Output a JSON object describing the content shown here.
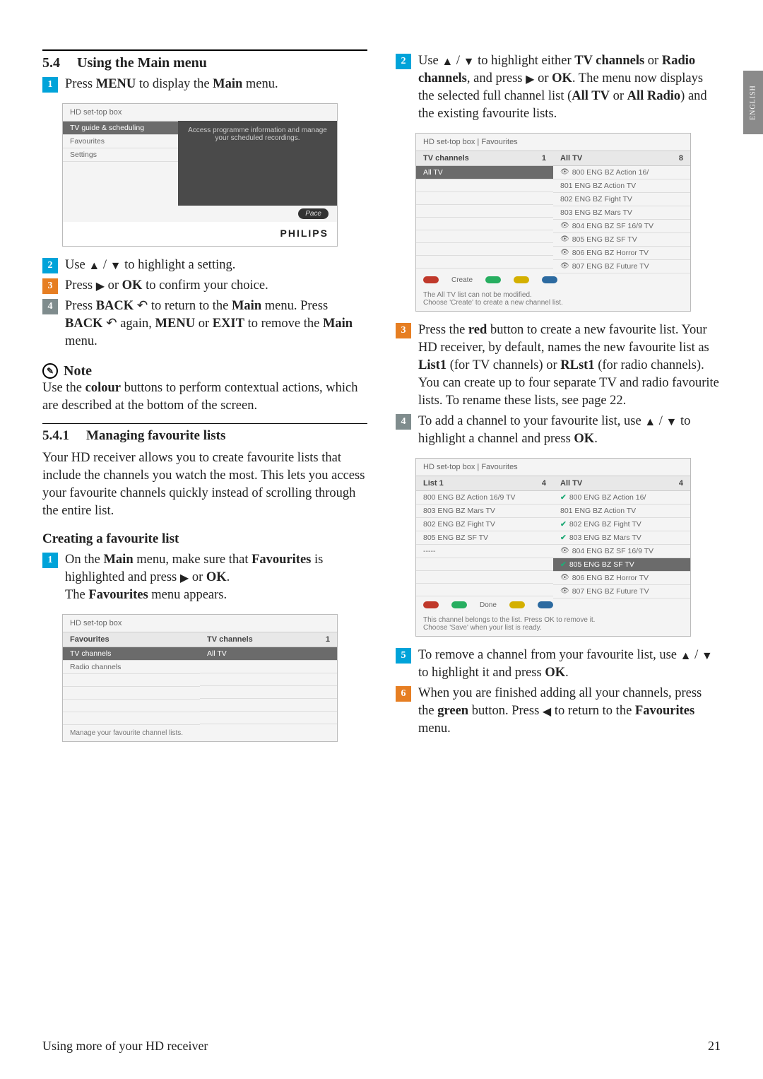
{
  "side_tab": "ENGLISH",
  "sec54": {
    "num": "5.4",
    "title": "Using the Main menu"
  },
  "sec541": {
    "num": "5.4.1",
    "title": "Managing favourite lists"
  },
  "create_hdr": "Creating a favourite list",
  "steps_left_a": {
    "s1": {
      "pre": "Press ",
      "b1": "MENU",
      "mid": " to display the ",
      "b2": "Main",
      "post": " menu."
    },
    "s2": {
      "pre": "Use ",
      "tri1": "▲",
      "slash": " / ",
      "tri2": "▼",
      "post": " to highlight a setting."
    },
    "s3": {
      "pre": "Press ",
      "tri": "▶",
      "mid": " or ",
      "b1": "OK",
      "post": " to confirm your choice."
    },
    "s4": {
      "pre": "Press ",
      "b1": "BACK",
      "icon": " ↶ ",
      "mid1": "to return to the ",
      "b2": "Main",
      "mid2": " menu. Press ",
      "b3": "BACK",
      "icon2": " ↶ ",
      "mid3": "again, ",
      "b4": "MENU",
      "mid4": " or ",
      "b5": "EXIT",
      "mid5": " to remove the ",
      "b6": "Main",
      "post": " menu."
    }
  },
  "note": {
    "label": "Note",
    "body_pre": "Use the ",
    "body_b": "colour",
    "body_post": " buttons to perform contextual actions, which are described at the bottom of the screen."
  },
  "para541": "Your HD receiver allows you to create favourite lists that include the channels you watch the most. This lets you access your favourite channels quickly instead of scrolling through the entire list.",
  "steps_left_b": {
    "s1": {
      "pre": "On the ",
      "b1": "Main",
      "mid1": " menu, make sure that ",
      "b2": "Favourites",
      "mid2": " is highlighted and press ",
      "tri": "▶",
      "mid3": " or ",
      "b3": "OK",
      "post": "."
    },
    "s1b": {
      "pre": "The ",
      "b1": "Favourites",
      "post": " menu appears."
    }
  },
  "steps_right": {
    "s2": {
      "pre": "Use ",
      "tri1": "▲",
      "slash": " / ",
      "tri2": "▼",
      "mid1": " to highlight either ",
      "b1": "TV channels",
      "mid2": " or ",
      "b2": "Radio channels",
      "mid3": ", and press ",
      "tri3": "▶",
      "mid4": " or ",
      "b3": "OK",
      "post1": ". The menu now displays the selected full channel list (",
      "b4": "All TV",
      "mid5": " or ",
      "b5": "All Radio",
      "post2": ") and the existing favourite lists."
    },
    "s3": {
      "pre": "Press the ",
      "b1": "red",
      "mid1": " button to create a new favourite list. Your HD receiver, by default, names the new favourite list as ",
      "b2": "List1",
      "mid2": " (for TV channels) or ",
      "b3": "RLst1",
      "post": " (for radio channels). You can create up to four separate TV and radio favourite lists. To rename these lists, see page 22."
    },
    "s4": {
      "pre": "To add a channel to your favourite list, use ",
      "tri1": "▲",
      "slash": " / ",
      "tri2": "▼",
      "mid": " to highlight a channel and press ",
      "b1": "OK",
      "post": "."
    },
    "s5": {
      "pre": "To remove a channel from your favourite list, use ",
      "tri1": "▲",
      "slash": " / ",
      "tri2": "▼",
      "mid": " to highlight it and press ",
      "b1": "OK",
      "post": "."
    },
    "s6": {
      "pre": "When you are finished adding all your channels, press the ",
      "b1": "green",
      "mid": " button. Press ",
      "tri": "◀",
      "mid2": " to return to the ",
      "b2": "Favourites",
      "post": " menu."
    }
  },
  "shot1": {
    "crumb": "HD set-top box",
    "menu": [
      "TV guide & scheduling",
      "Favourites",
      "Settings"
    ],
    "right_text": "Access programme information and manage your scheduled recordings.",
    "pace": "Pace",
    "brand": "PHILIPS"
  },
  "shot2": {
    "crumb": "HD set-top box",
    "left_hdr": "Favourites",
    "left": [
      "TV channels",
      "Radio channels"
    ],
    "right_hdr": "TV channels",
    "right_count": "1",
    "right": [
      "All TV"
    ],
    "hint": "Manage your favourite channel lists."
  },
  "shot3": {
    "crumb": "HD set-top box | Favourites",
    "left_hdr": "TV channels",
    "left_count": "1",
    "left": [
      "All TV"
    ],
    "right_hdr": "All TV",
    "right_count": "8",
    "right": [
      "800 ENG BZ Action 16/",
      "801 ENG BZ Action TV",
      "802 ENG BZ Fight TV",
      "803 ENG BZ Mars TV",
      "804 ENG BZ SF 16/9 TV",
      "805 ENG BZ SF TV",
      "806 ENG BZ Horror TV",
      "807 ENG BZ Future TV"
    ],
    "btn_create": "Create",
    "hint1": "The All TV list can not be modified.",
    "hint2": "Choose 'Create' to create a new channel list."
  },
  "shot4": {
    "crumb": "HD set-top box | Favourites",
    "left_hdr": "List 1",
    "left_count": "4",
    "left": [
      "800 ENG BZ Action 16/9 TV",
      "803 ENG BZ Mars TV",
      "802 ENG BZ Fight TV",
      "805 ENG BZ SF TV",
      "-----"
    ],
    "right_hdr": "All TV",
    "right_count": "4",
    "right": [
      {
        "t": "800 ENG BZ Action 16/",
        "chk": true
      },
      {
        "t": "801 ENG BZ Action TV",
        "chk": false
      },
      {
        "t": "802 ENG BZ Fight TV",
        "chk": true
      },
      {
        "t": "803 ENG BZ Mars TV",
        "chk": true
      },
      {
        "t": "804 ENG BZ SF 16/9 TV",
        "chk": false,
        "eye": true
      },
      {
        "t": "805 ENG BZ SF TV",
        "chk": true,
        "sel": true
      },
      {
        "t": "806 ENG BZ Horror TV",
        "chk": false,
        "eye": true
      },
      {
        "t": "807 ENG BZ Future TV",
        "chk": false,
        "eye": true
      }
    ],
    "btn_done": "Done",
    "hint1": "This channel belongs to the list. Press OK to remove it.",
    "hint2": "Choose 'Save' when your list is ready."
  },
  "step_colors": {
    "c1": "#00a3d9",
    "c2": "#00a3d9",
    "c3": "#e67e22",
    "c4": "#7f8c8d",
    "c5": "#00a3d9",
    "c6": "#e67e22"
  },
  "footer": {
    "left": "Using more of your HD receiver",
    "right": "21"
  }
}
